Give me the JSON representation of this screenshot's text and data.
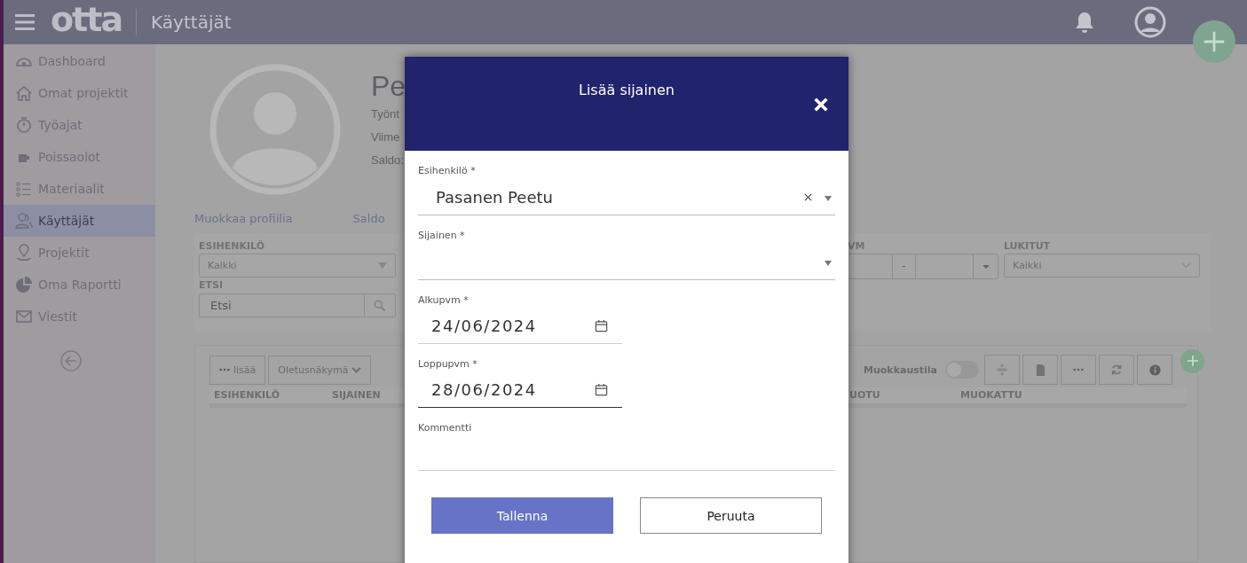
{
  "header": {
    "logo": "otta",
    "title": "Käyttäjät"
  },
  "sidebar": {
    "items": [
      {
        "label": "Dashboard",
        "selected": false
      },
      {
        "label": "Omat projektit",
        "selected": false
      },
      {
        "label": "Työajat",
        "selected": false
      },
      {
        "label": "Poissaolot",
        "selected": false
      },
      {
        "label": "Materiaalit",
        "selected": false
      },
      {
        "label": "Käyttäjät",
        "selected": true
      },
      {
        "label": "Projektit",
        "selected": false
      },
      {
        "label": "Oma Raportti",
        "selected": false
      },
      {
        "label": "Viestit",
        "selected": false
      }
    ]
  },
  "profile": {
    "name": "Pe",
    "lines": [
      "Työnt",
      "Viime",
      "Saldo:"
    ]
  },
  "tabs": [
    {
      "label": "Muokkaa profiilia"
    },
    {
      "label": "Saldo"
    }
  ],
  "filters": {
    "supervisor": {
      "label": "ESIHENKILÖ",
      "value": "Kaikki"
    },
    "search": {
      "label": "ETSI",
      "placeholder": "Etsi"
    },
    "date": {
      "label": "VM",
      "separator": "-"
    },
    "locked": {
      "label": "LUKITUT",
      "value": "Kaikki"
    }
  },
  "table": {
    "more_button": "lisää",
    "view_button": "Oletusnäkymä",
    "edit_mode": {
      "label": "Muokkaustila",
      "on": false
    },
    "columns": [
      "ESIHENKILÖ",
      "SIJAINEN",
      "UOTU",
      "MUOKATTU"
    ]
  },
  "modal": {
    "title": "Lisää sijainen",
    "fields": [
      {
        "kind": "select",
        "label": "Esihenkilö *",
        "value": "Pasanen Peetu",
        "clearable": true,
        "focused": false
      },
      {
        "kind": "select",
        "label": "Sijainen *",
        "clearable": false,
        "focused": false
      },
      {
        "kind": "date",
        "label": "Alkupvm *",
        "value": "24/06/2024",
        "focused": false
      },
      {
        "kind": "date",
        "label": "Loppupvm *",
        "value": "28/06/2024",
        "focused": true
      },
      {
        "kind": "text",
        "label": "Kommentti",
        "focused": false
      }
    ],
    "buttons": [
      {
        "kind": "primary",
        "label": "Tallenna"
      },
      {
        "kind": "secondary",
        "label": "Peruuta"
      }
    ]
  }
}
